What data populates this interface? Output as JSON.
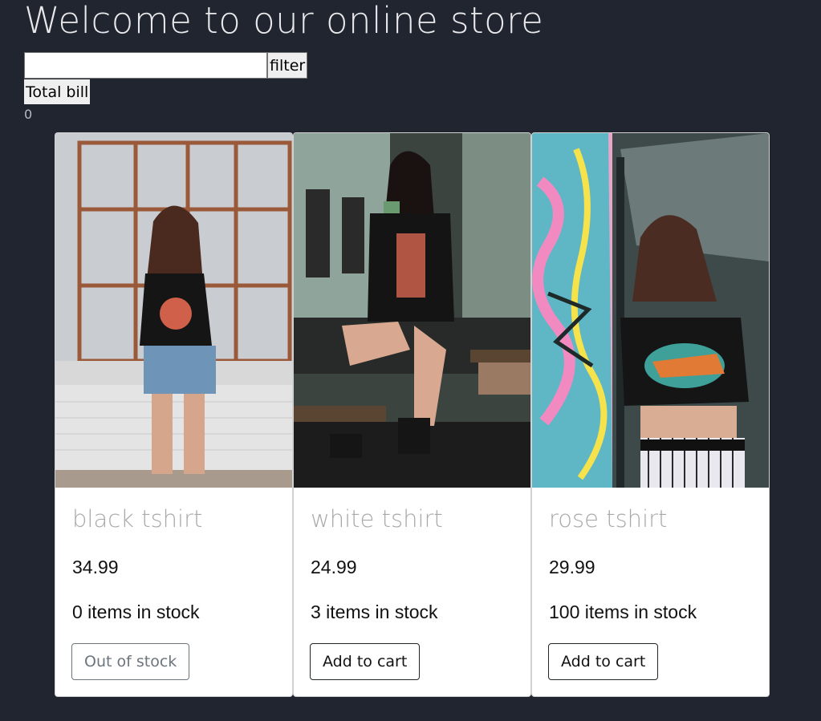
{
  "header": {
    "title": "Welcome to our online store"
  },
  "filter": {
    "input_value": "",
    "button_label": "filter"
  },
  "bill": {
    "button_label": "Total bill",
    "total": "0"
  },
  "products": [
    {
      "name": "black tshirt",
      "price": "34.99",
      "stock_text": "0 items in stock",
      "button_label": "Out of stock",
      "button_enabled": false
    },
    {
      "name": "white tshirt",
      "price": "24.99",
      "stock_text": "3 items in stock",
      "button_label": "Add to cart",
      "button_enabled": true
    },
    {
      "name": "rose tshirt",
      "price": "29.99",
      "stock_text": "100 items in stock",
      "button_label": "Add to cart",
      "button_enabled": true
    }
  ],
  "colors": {
    "background": "#202530",
    "title_text": "#e9e9ec",
    "product_name": "#a9a9a9",
    "card_background": "#ffffff"
  }
}
